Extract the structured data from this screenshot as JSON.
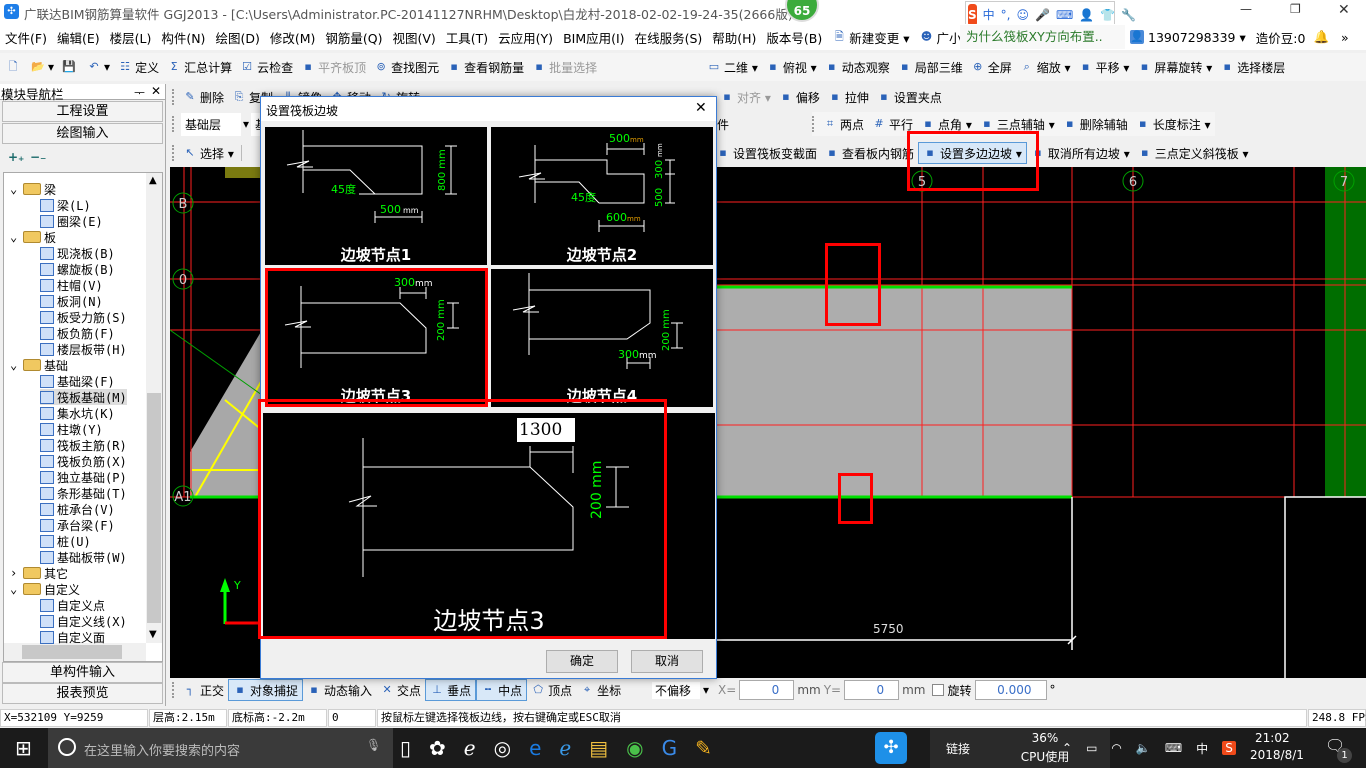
{
  "title": {
    "text": "广联达BIM钢筋算量软件 GGJ2013 - [C:\\Users\\Administrator.PC-20141127NRHM\\Desktop\\白龙村-2018-02-02-19-24-35(2666版).GGJ12",
    "badge": "65",
    "ime": [
      "中",
      "°,",
      "☺",
      "🎤",
      "⌨",
      "👤",
      "👕",
      "🔧"
    ]
  },
  "menu": [
    {
      "label": "文件(F)"
    },
    {
      "label": "编辑(E)"
    },
    {
      "label": "楼层(L)"
    },
    {
      "label": "构件(N)"
    },
    {
      "label": "绘图(D)"
    },
    {
      "label": "修改(M)"
    },
    {
      "label": "钢筋量(Q)"
    },
    {
      "label": "视图(V)"
    },
    {
      "label": "工具(T)"
    },
    {
      "label": "云应用(Y)"
    },
    {
      "label": "BIM应用(I)"
    },
    {
      "label": "在线服务(S)"
    },
    {
      "label": "帮助(H)"
    },
    {
      "label": "版本号(B)"
    },
    {
      "label": "新建变更 ▾",
      "icon": "document-icon"
    },
    {
      "label": "广小二",
      "icon": "mascot-icon"
    }
  ],
  "menu_right": {
    "question": "为什么筏板XY方向布置..",
    "account": "13907298339",
    "beans": "造价豆:0"
  },
  "toolbar1": [
    {
      "label": "",
      "icon": "new-file-icon"
    },
    {
      "label": "▾",
      "icon": "open-folder-icon"
    },
    {
      "label": "",
      "icon": "save-icon"
    },
    {
      "label": "▾",
      "icon": "undo-icon"
    },
    {
      "label": "定义",
      "icon": "define-icon"
    },
    {
      "label": "汇总计算",
      "icon": "sigma-icon"
    },
    {
      "label": "云检查",
      "icon": "cloud-check-icon"
    },
    {
      "label": "平齐板顶",
      "icon": "align-top-icon",
      "disabled": true
    },
    {
      "label": "查找图元",
      "icon": "binoculars-icon"
    },
    {
      "label": "查看钢筋量",
      "icon": "rebar-icon"
    },
    {
      "label": "批量选择",
      "icon": "batch-select-icon",
      "disabled": true
    }
  ],
  "toolbar1_right": [
    {
      "label": "二维 ▾",
      "icon": "2d-icon"
    },
    {
      "label": "俯视 ▾",
      "icon": "top-view-icon"
    },
    {
      "label": "动态观察",
      "icon": "orbit-icon"
    },
    {
      "label": "局部三维",
      "icon": "local-3d-icon"
    },
    {
      "label": "全屏",
      "icon": "fullscreen-icon"
    },
    {
      "label": "缩放 ▾",
      "icon": "zoom-icon"
    },
    {
      "label": "平移 ▾",
      "icon": "pan-icon"
    },
    {
      "label": "屏幕旋转 ▾",
      "icon": "rotate-screen-icon"
    },
    {
      "label": "选择楼层",
      "icon": "floor-select-icon"
    }
  ],
  "edit_toolbar": [
    {
      "label": "删除",
      "icon": "delete-icon"
    },
    {
      "label": "复制",
      "icon": "copy-icon"
    },
    {
      "label": "镜像",
      "icon": "mirror-icon"
    },
    {
      "label": "移动",
      "icon": "move-icon"
    },
    {
      "label": "旋转",
      "icon": "rotate-icon"
    }
  ],
  "edit_toolbar_right": [
    {
      "label": "对齐 ▾",
      "icon": "align-icon",
      "disabled": true
    },
    {
      "label": "偏移",
      "icon": "offset-icon"
    },
    {
      "label": "拉伸",
      "icon": "stretch-icon"
    },
    {
      "label": "设置夹点",
      "icon": "grip-point-icon"
    }
  ],
  "layer_toolbar": {
    "floor": "基础层",
    "component_type": "基础",
    "component_suffix": "件"
  },
  "axis_toolbar": [
    {
      "label": "两点",
      "icon": "two-point-axis-icon"
    },
    {
      "label": "平行",
      "icon": "parallel-axis-icon"
    },
    {
      "label": "点角 ▾",
      "icon": "point-angle-icon"
    },
    {
      "label": "三点辅轴 ▾",
      "icon": "three-point-axis-icon"
    },
    {
      "label": "删除辅轴",
      "icon": "delete-axis-icon"
    },
    {
      "label": "长度标注 ▾",
      "icon": "dimension-icon"
    }
  ],
  "draw_toolbar": {
    "select": "选择 ▾"
  },
  "raft_toolbar": [
    {
      "label": "设置筏板变截面",
      "icon": "variable-section-icon"
    },
    {
      "label": "查看板内钢筋",
      "icon": "view-rebar-icon"
    },
    {
      "label": "设置多边边坡 ▾",
      "icon": "multi-slope-icon",
      "active": true
    },
    {
      "label": "取消所有边坡 ▾",
      "icon": "cancel-slope-icon"
    },
    {
      "label": "三点定义斜筏板 ▾",
      "icon": "inclined-raft-icon"
    }
  ],
  "nav": {
    "title": "模块导航栏",
    "pin": "ᅮ",
    "close": "✕",
    "project_settings": "工程设置",
    "drawing_input": "绘图输入",
    "single_input": "单构件输入",
    "report_preview": "报表预览",
    "expand": "+₊",
    "collapse": "−₋"
  },
  "tree": [
    {
      "label": "梁",
      "level": 0,
      "folder": true,
      "open": true
    },
    {
      "label": "梁(L)",
      "level": 1
    },
    {
      "label": "圈梁(E)",
      "level": 1
    },
    {
      "label": "板",
      "level": 0,
      "folder": true,
      "open": true
    },
    {
      "label": "现浇板(B)",
      "level": 1
    },
    {
      "label": "螺旋板(B)",
      "level": 1
    },
    {
      "label": "柱帽(V)",
      "level": 1
    },
    {
      "label": "板洞(N)",
      "level": 1
    },
    {
      "label": "板受力筋(S)",
      "level": 1
    },
    {
      "label": "板负筋(F)",
      "level": 1
    },
    {
      "label": "楼层板带(H)",
      "level": 1
    },
    {
      "label": "基础",
      "level": 0,
      "folder": true,
      "open": true
    },
    {
      "label": "基础梁(F)",
      "level": 1
    },
    {
      "label": "筏板基础(M)",
      "level": 1,
      "selected": true
    },
    {
      "label": "集水坑(K)",
      "level": 1
    },
    {
      "label": "柱墩(Y)",
      "level": 1
    },
    {
      "label": "筏板主筋(R)",
      "level": 1
    },
    {
      "label": "筏板负筋(X)",
      "level": 1
    },
    {
      "label": "独立基础(P)",
      "level": 1
    },
    {
      "label": "条形基础(T)",
      "level": 1
    },
    {
      "label": "桩承台(V)",
      "level": 1
    },
    {
      "label": "承台梁(F)",
      "level": 1
    },
    {
      "label": "桩(U)",
      "level": 1
    },
    {
      "label": "基础板带(W)",
      "level": 1
    },
    {
      "label": "其它",
      "level": 0,
      "folder": true,
      "open": false
    },
    {
      "label": "自定义",
      "level": 0,
      "folder": true,
      "open": true
    },
    {
      "label": "自定义点",
      "level": 1
    },
    {
      "label": "自定义线(X)",
      "level": 1
    },
    {
      "label": "自定义面",
      "level": 1
    }
  ],
  "canvas": {
    "axes": [
      "B",
      "0",
      "A1",
      "5",
      "6",
      "7"
    ],
    "dimension": "5750",
    "y_axis": "Y"
  },
  "dialog": {
    "title": "设置筏板边坡",
    "close": "✕",
    "ok": "确定",
    "cancel": "取消",
    "nodes": [
      {
        "label": "边坡节点1",
        "angle": "45度",
        "width": "500",
        "width_unit": "mm",
        "height": "800 mm"
      },
      {
        "label": "边坡节点2",
        "top": "500",
        "top_unit": "mm",
        "h1": "300",
        "h2": "500",
        "unit": "mm",
        "angle": "45度",
        "bottom": "600",
        "bottom_unit": "mm"
      },
      {
        "label": "边坡节点3",
        "width": "300",
        "width_unit": "mm",
        "height": "200 mm",
        "selected": true
      },
      {
        "label": "边坡节点4",
        "width": "300",
        "width_unit": "mm",
        "height": "200 mm"
      }
    ],
    "preview": {
      "label": "边坡节点3",
      "width_input": "1300",
      "height": "200 mm"
    }
  },
  "snap": [
    {
      "label": "正交",
      "icon": "ortho-icon"
    },
    {
      "label": "对象捕捉",
      "icon": "object-snap-icon",
      "active": true
    },
    {
      "label": "动态输入",
      "icon": "dynamic-input-icon"
    },
    {
      "label": "交点",
      "icon": "intersection-icon"
    },
    {
      "label": "垂点",
      "icon": "perpendicular-icon",
      "active": true
    },
    {
      "label": "中点",
      "icon": "midpoint-icon",
      "active": true
    },
    {
      "label": "顶点",
      "icon": "vertex-icon"
    },
    {
      "label": "坐标",
      "icon": "coordinate-icon"
    }
  ],
  "snap_fields": {
    "offset": "不偏移",
    "x_label": "X=",
    "x": "0",
    "x_unit": "mm",
    "y_label": "Y=",
    "y": "0",
    "y_unit": "mm",
    "rotate_label": "旋转",
    "rotate": "0.000",
    "deg": "°",
    "rotate_checked": false
  },
  "status": {
    "coords": "X=532109 Y=9259",
    "floor_height": "层高:2.15m",
    "bottom_elev": "底标高:-2.2m",
    "value": "0",
    "hint": "按鼠标左键选择筏板边线，按右键确定或ESC取消",
    "fps": "248.8 FPS"
  },
  "taskbar": {
    "search": "在这里输入你要搜索的内容",
    "link": "链接",
    "cpu": "36%",
    "cpu_label": "CPU使用",
    "ime": "中",
    "time": "21:02",
    "date": "2018/8/1",
    "notifications": "1"
  },
  "colors": {
    "highlight": "#ff0000",
    "grid": "#ff0000",
    "slab": "#adadad",
    "edge": "#00e000",
    "dim_text": "#00e000"
  }
}
